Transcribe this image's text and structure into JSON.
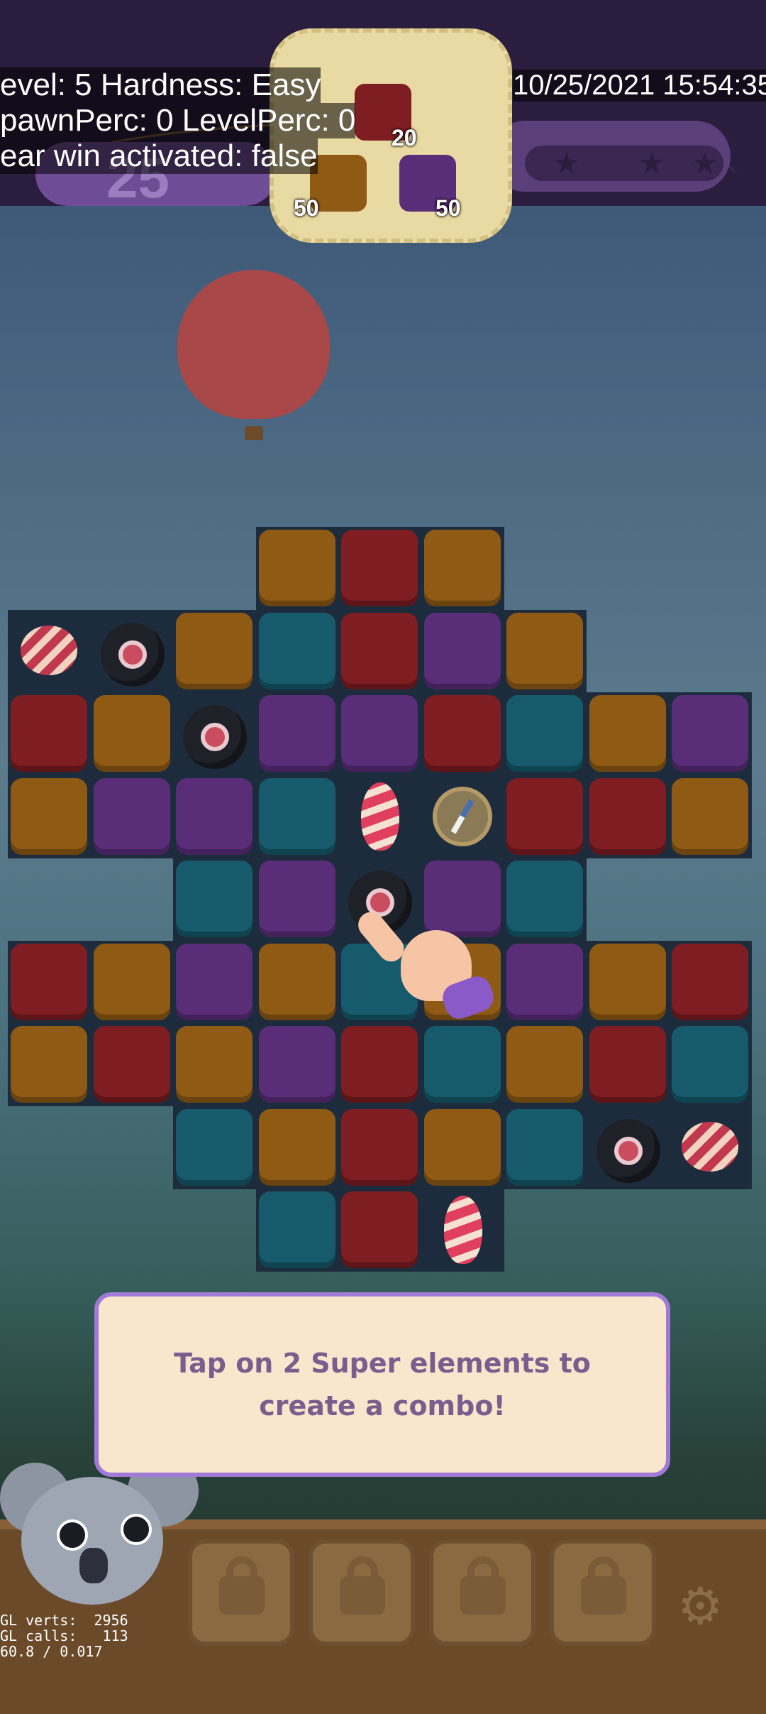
{
  "debug": {
    "line1": "evel: 5 Hardness: Easy",
    "line2": "pawnPerc: 0 LevelPerc: 0",
    "line3": "ear win activated: false",
    "datetime": "10/25/2021 15:54:35",
    "gl_verts": "GL verts:  2956",
    "gl_calls": "GL calls:   113",
    "fps": "60.8 / 0.017"
  },
  "hud": {
    "moves": "25",
    "goals": [
      {
        "color": "red",
        "count": "20"
      },
      {
        "color": "orange",
        "count": "50"
      },
      {
        "color": "purple",
        "count": "50"
      }
    ],
    "stars": 3
  },
  "tooltip": {
    "text": "Tap on 2 Super elements to create a combo!"
  },
  "boosters": [
    {
      "locked": true
    },
    {
      "locked": true
    },
    {
      "locked": true
    },
    {
      "locked": true
    }
  ],
  "icons": {
    "settings": "gear-icon",
    "lock": "lock-icon",
    "star": "star-icon"
  },
  "colors": {
    "red": "#7e1d22",
    "orange": "#8e5a14",
    "blue": "#165a6b",
    "purple": "#5a2d78",
    "tooltip_bg": "#f8e6cd",
    "tooltip_border": "#a07ad6",
    "tooltip_text": "#7a5f8e"
  },
  "board": {
    "rows": [
      [
        "",
        "",
        "",
        "O",
        "R",
        "O",
        "",
        "",
        ""
      ],
      [
        "candy",
        "bomb",
        "O",
        "B",
        "R",
        "P",
        "O",
        "",
        ""
      ],
      [
        "R",
        "O",
        "bomb",
        "P",
        "P",
        "R",
        "B",
        "O",
        "P"
      ],
      [
        "O",
        "P",
        "P",
        "B",
        "rocket",
        "compass",
        "R",
        "R",
        "O"
      ],
      [
        "",
        "",
        "B",
        "P",
        "bomb",
        "P",
        "B",
        "",
        ""
      ],
      [
        "R",
        "O",
        "P",
        "O",
        "B",
        "O",
        "P",
        "O",
        "R"
      ],
      [
        "O",
        "R",
        "O",
        "P",
        "R",
        "B",
        "O",
        "R",
        "B"
      ],
      [
        "",
        "",
        "B",
        "O",
        "R",
        "O",
        "B",
        "bomb",
        "candy"
      ],
      [
        "",
        "",
        "",
        "B",
        "R",
        "rocket",
        "",
        "",
        ""
      ]
    ]
  }
}
